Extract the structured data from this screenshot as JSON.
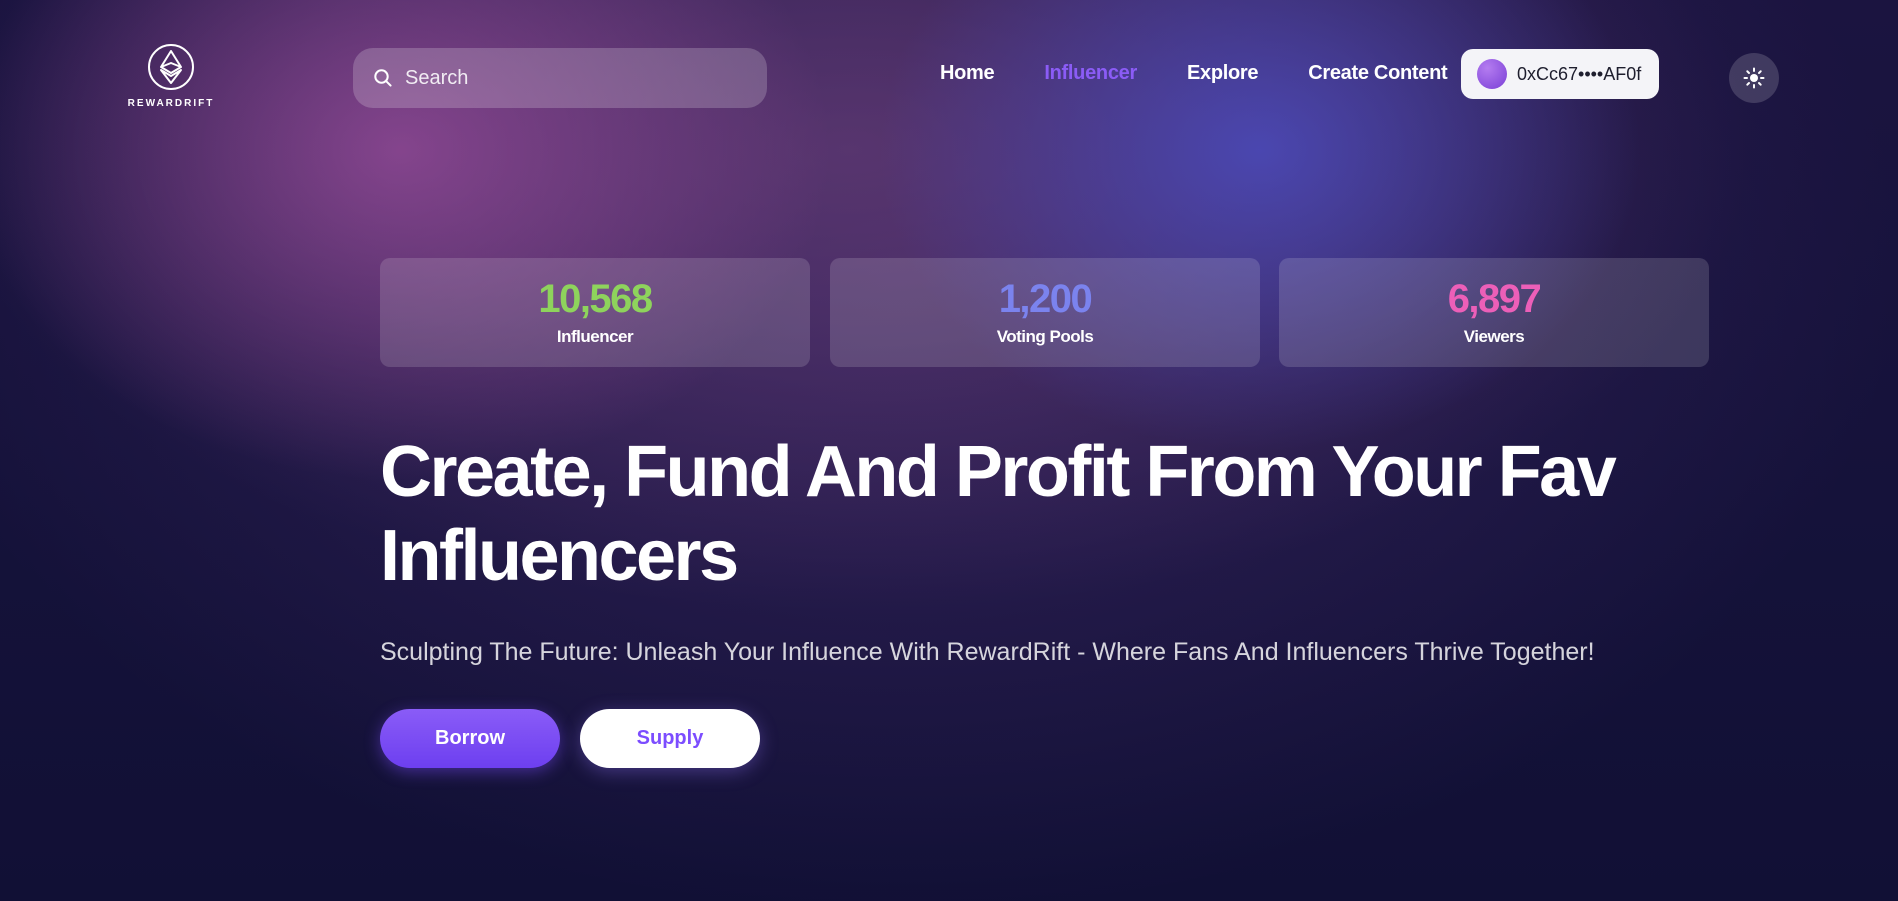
{
  "brand": {
    "name": "REWARDRIFT"
  },
  "search": {
    "placeholder": "Search",
    "value": ""
  },
  "nav": {
    "items": [
      {
        "label": "Home",
        "active": false
      },
      {
        "label": "Influencer",
        "active": true
      },
      {
        "label": "Explore",
        "active": false
      },
      {
        "label": "Create Content",
        "active": false
      }
    ],
    "active_color": "#8b5cf6"
  },
  "wallet": {
    "address": "0xCc67••••AF0f"
  },
  "theme_toggle": {
    "icon": "sun-icon"
  },
  "stats": [
    {
      "value": "10,568",
      "label": "Influencer",
      "color": "#8ed35c"
    },
    {
      "value": "1,200",
      "label": "Voting Pools",
      "color": "#7b83ee"
    },
    {
      "value": "6,897",
      "label": "Viewers",
      "color": "#ec5fb8"
    }
  ],
  "hero": {
    "headline": "Create, Fund And Profit From Your Fav Influencers",
    "subtitle": "Sculpting The Future: Unleash Your Influence With RewardRift - Where Fans And Influencers Thrive Together!"
  },
  "actions": {
    "borrow_label": "Borrow",
    "supply_label": "Supply"
  },
  "colors": {
    "accent": "#7c4dff"
  }
}
